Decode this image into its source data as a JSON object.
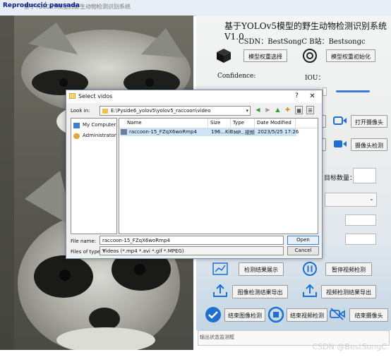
{
  "window": {
    "title": "基于YOLOv5模型的野生动物检测识别系统",
    "toast": "Reproducció pausada"
  },
  "app": {
    "title": "基于YOLOv5模型的野生动物检测识别系统V1.0",
    "csdn_line": "CSDN：BestSongC  B站：Bestsongc",
    "confidence_label": "Confidence:",
    "iou_label": "IOU：",
    "target_count_label": "目标数量：",
    "buttons": {
      "model_select": "模型权重选择",
      "model_init": "模型权重初始化",
      "open_camera": "打开摄像头",
      "camera_detect": "摄像头检测",
      "show_results": "检测结果展示",
      "pause_video": "暂停视频检测",
      "export_image": "图像检测结果导出",
      "export_video": "视频检测结果导出",
      "end_image": "结束图像检测",
      "end_video": "结束视频检测",
      "end_camera": "结束摄像头"
    },
    "status_placeholder": "输出状态监测框"
  },
  "dialog": {
    "title": "Select vidos",
    "look_in_label": "Look in:",
    "look_in_path": "E:\\Pyside6_yolov5\\yolov5_raccoon\\video",
    "sidebar": [
      {
        "label": "My Computer",
        "icon": "computer-icon"
      },
      {
        "label": "Administrator",
        "icon": "user-icon"
      }
    ],
    "columns": [
      "Name",
      "Size",
      "Type",
      "Date Modified"
    ],
    "files": [
      {
        "name": "raccoon-15_FZqX6woRmp4",
        "size": "196...KiB",
        "type": "MP...视频",
        "date": "2023/5/25 17:26"
      }
    ],
    "file_name_label": "File name:",
    "file_name_value": "raccoon-15_FZqX6woRmp4",
    "file_type_label": "Files of type:",
    "file_type_value": "Videos (*.mp4 *.avi *.gif *.MPEG)",
    "open_label": "Open",
    "cancel_label": "Cancel"
  },
  "watermark": "CSDN @BestSongC"
}
